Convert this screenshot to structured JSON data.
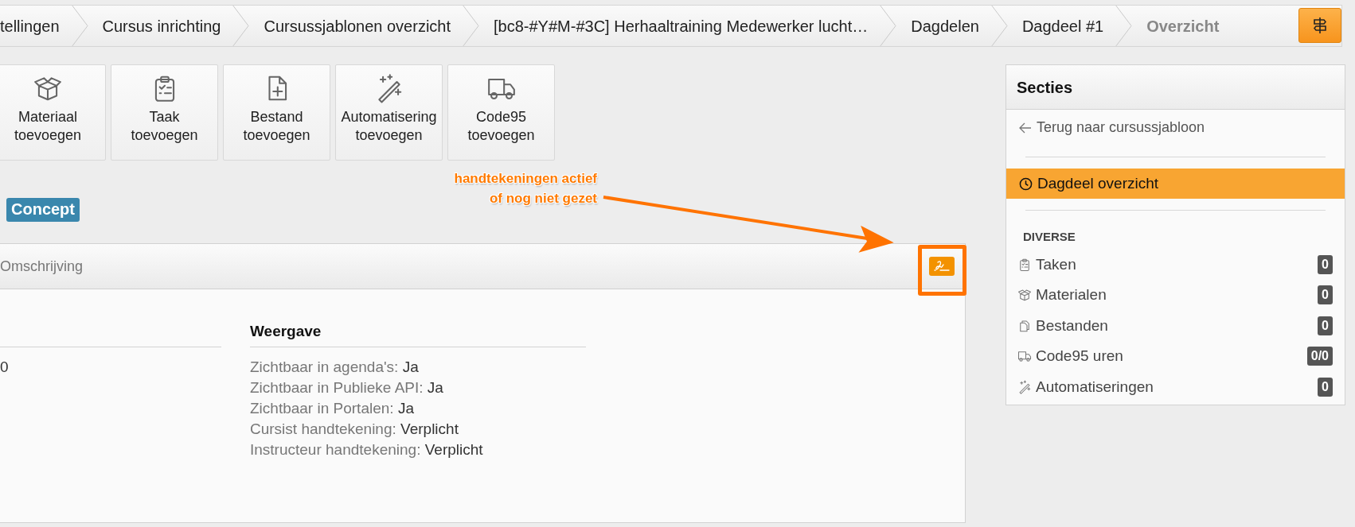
{
  "breadcrumbs": [
    {
      "label": "tellingen",
      "current": false
    },
    {
      "label": "Cursus inrichting",
      "current": false
    },
    {
      "label": "Cursussjablonen overzicht",
      "current": false
    },
    {
      "label": "[bc8-#Y#M-#3C] Herhaaltraining Medewerker lucht…",
      "current": false
    },
    {
      "label": "Dagdelen",
      "current": false
    },
    {
      "label": "Dagdeel #1",
      "current": false
    },
    {
      "label": "Overzicht",
      "current": true
    }
  ],
  "toolbar_buttons": [
    {
      "kind": "box",
      "label": "Materiaal\ntoevoegen"
    },
    {
      "kind": "clipboard",
      "label": "Taak\ntoevoegen"
    },
    {
      "kind": "file",
      "label": "Bestand\ntoevoegen"
    },
    {
      "kind": "wand",
      "label": "Automatisering\ntoevoegen"
    },
    {
      "kind": "truck",
      "label": "Code95\ntoevoegen"
    }
  ],
  "status_badge": "Concept",
  "annotation": {
    "text": "handtekeningen actief\nof nog niet gezet"
  },
  "card": {
    "title": "Omschrijving",
    "signature_button": {
      "highlighted": true
    },
    "column_1": {
      "values": [
        "0"
      ]
    },
    "display": {
      "heading": "Weergave",
      "rows": [
        {
          "label": "Zichtbaar in agenda's:",
          "value": "Ja"
        },
        {
          "label": "Zichtbaar in Publieke API:",
          "value": "Ja"
        },
        {
          "label": "Zichtbaar in Portalen:",
          "value": "Ja"
        },
        {
          "label": "Cursist handtekening:",
          "value": "Verplicht"
        },
        {
          "label": "Instructeur handtekening:",
          "value": "Verplicht"
        }
      ]
    }
  },
  "sidebar": {
    "title": "Secties",
    "back_link": "Terug naar cursussjabloon",
    "nav": [
      {
        "label": "Dagdeel overzicht",
        "selected": true
      }
    ],
    "group_heading": "DIVERSE",
    "items": [
      {
        "kind": "clipboard",
        "label": "Taken",
        "count": "0"
      },
      {
        "kind": "box",
        "label": "Materialen",
        "count": "0"
      },
      {
        "kind": "files",
        "label": "Bestanden",
        "count": "0"
      },
      {
        "kind": "truck",
        "label": "Code95 uren",
        "count": "0/0"
      },
      {
        "kind": "wand",
        "label": "Automatiseringen",
        "count": "0"
      }
    ]
  }
}
